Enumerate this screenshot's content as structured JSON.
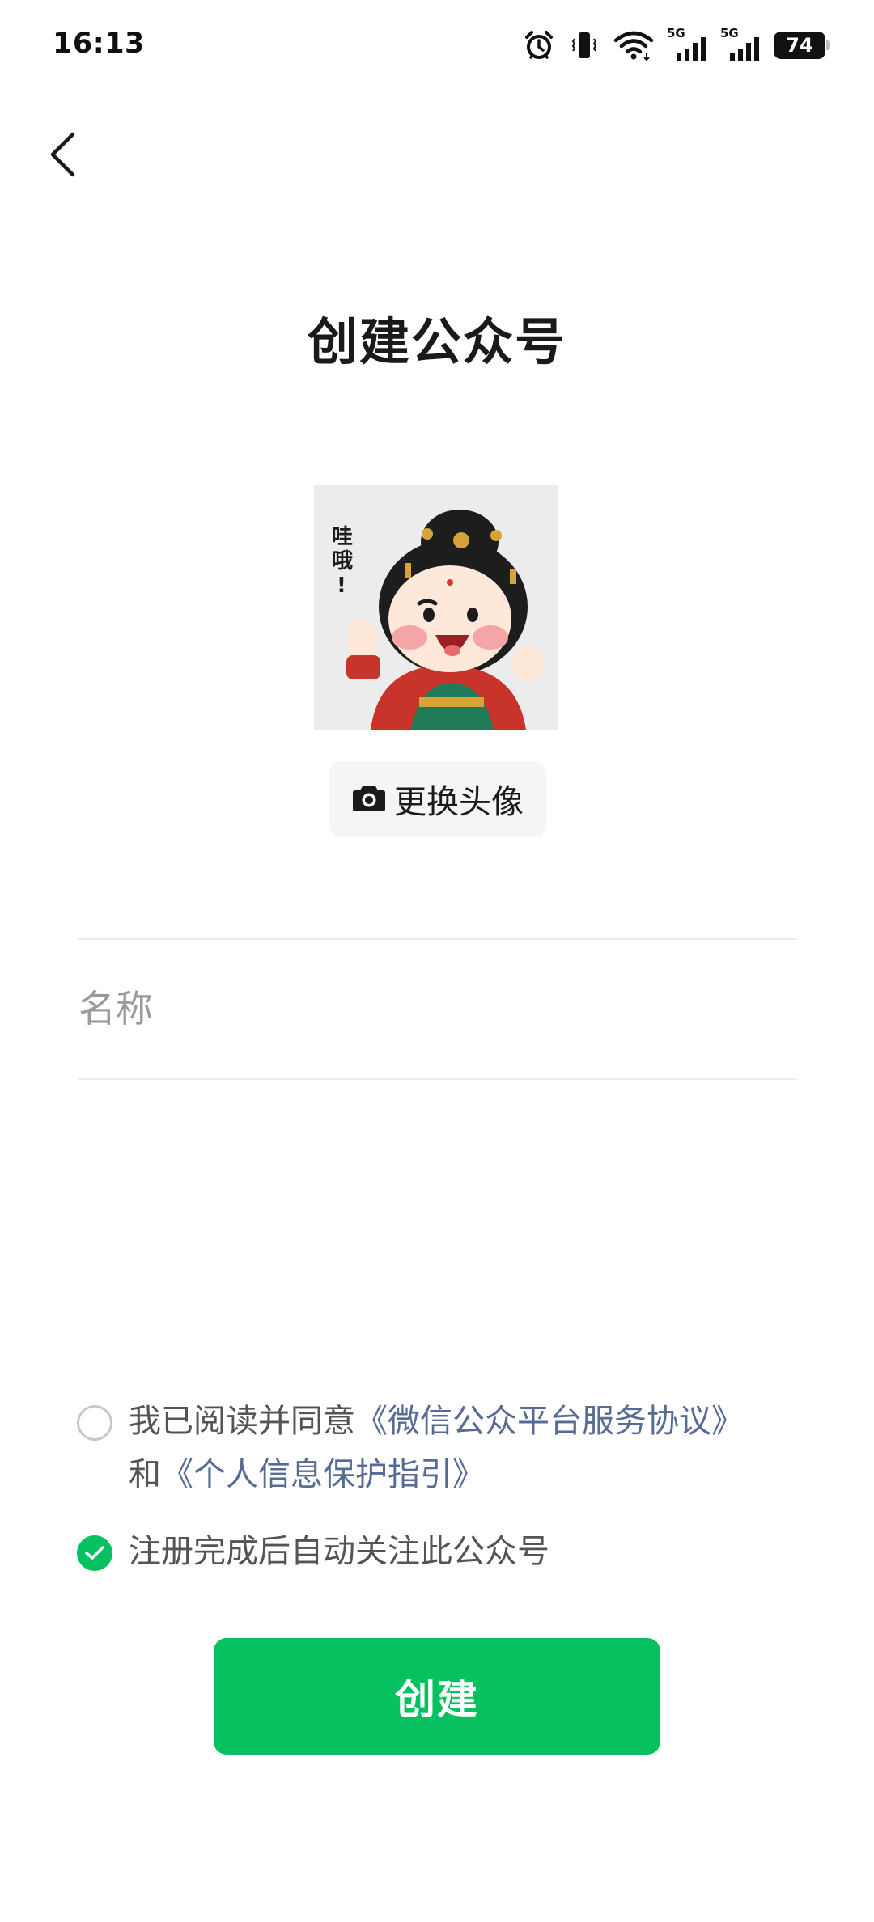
{
  "status_bar": {
    "time": "16:13",
    "network_1": "5G",
    "network_2": "5G",
    "battery": "74",
    "icons": [
      "alarm-icon",
      "vibrate-icon",
      "wifi-icon",
      "signal-icon",
      "signal-icon",
      "battery-icon"
    ]
  },
  "header": {
    "back_icon": "chevron-left-icon",
    "title": "创建公众号"
  },
  "avatar": {
    "image_text": "哇哦！",
    "change_label": "更换头像",
    "camera_icon": "camera-icon"
  },
  "form": {
    "name_placeholder": "名称",
    "name_value": ""
  },
  "agreements": {
    "prefix": "我已阅读并同意",
    "service_link": "《微信公众平台服务协议》",
    "middle": "和",
    "privacy_link": "《个人信息保护指引》",
    "agreement_checked": false,
    "auto_follow_label": "注册完成后自动关注此公众号",
    "auto_follow_checked": true
  },
  "actions": {
    "create_label": "创建"
  },
  "colors": {
    "accent": "#07c160",
    "link": "#576b95",
    "text_secondary": "#545454",
    "placeholder": "#9a9a9a"
  }
}
